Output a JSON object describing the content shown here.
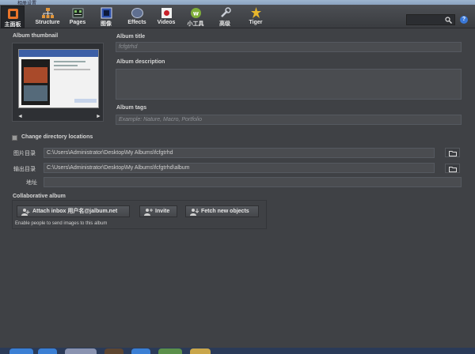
{
  "window": {
    "title": "相册设置"
  },
  "toolbar": {
    "items": [
      {
        "label": "主面板",
        "icon": "home-icon",
        "active": true
      },
      {
        "label": "Structure",
        "icon": "structure-icon"
      },
      {
        "label": "Pages",
        "icon": "pages-icon"
      },
      {
        "label": "图像",
        "icon": "images-icon"
      },
      {
        "label": "Effects",
        "icon": "effects-icon"
      },
      {
        "label": "Videos",
        "icon": "videos-icon"
      },
      {
        "label": "小工具",
        "icon": "widgets-icon"
      },
      {
        "label": "高级",
        "icon": "advanced-icon"
      },
      {
        "label": "Tiger",
        "icon": "tiger-icon"
      }
    ],
    "search_placeholder": ""
  },
  "thumbnail": {
    "label": "Album thumbnail",
    "prev": "◄",
    "next": "►"
  },
  "album": {
    "title_label": "Album title",
    "title_value": "fcfgtrhd",
    "description_label": "Album description",
    "description_value": "",
    "tags_label": "Album tags",
    "tags_placeholder": "Example: Nature, Macro, Portfolio"
  },
  "directories": {
    "change_label": "Change directory locations",
    "image_dir_label": "图片目录",
    "image_dir_value": "C:\\Users\\Administrator\\Desktop\\My Albums\\fcfgtrhd",
    "output_dir_label": "输出目录",
    "output_dir_value": "C:\\Users\\Administrator\\Desktop\\My Albums\\fcfgtrhd\\album",
    "address_label": "地址",
    "address_value": ""
  },
  "collab": {
    "label": "Collaborative album",
    "attach_label": "Attach inbox 用户名@jalbum.net",
    "invite_label": "Invite",
    "fetch_label": "Fetch new objects",
    "note": "Enable people to send images to this album"
  },
  "colors": {
    "background": "#3f4145",
    "field": "#4a4c50",
    "accent": "#3a78d8"
  }
}
